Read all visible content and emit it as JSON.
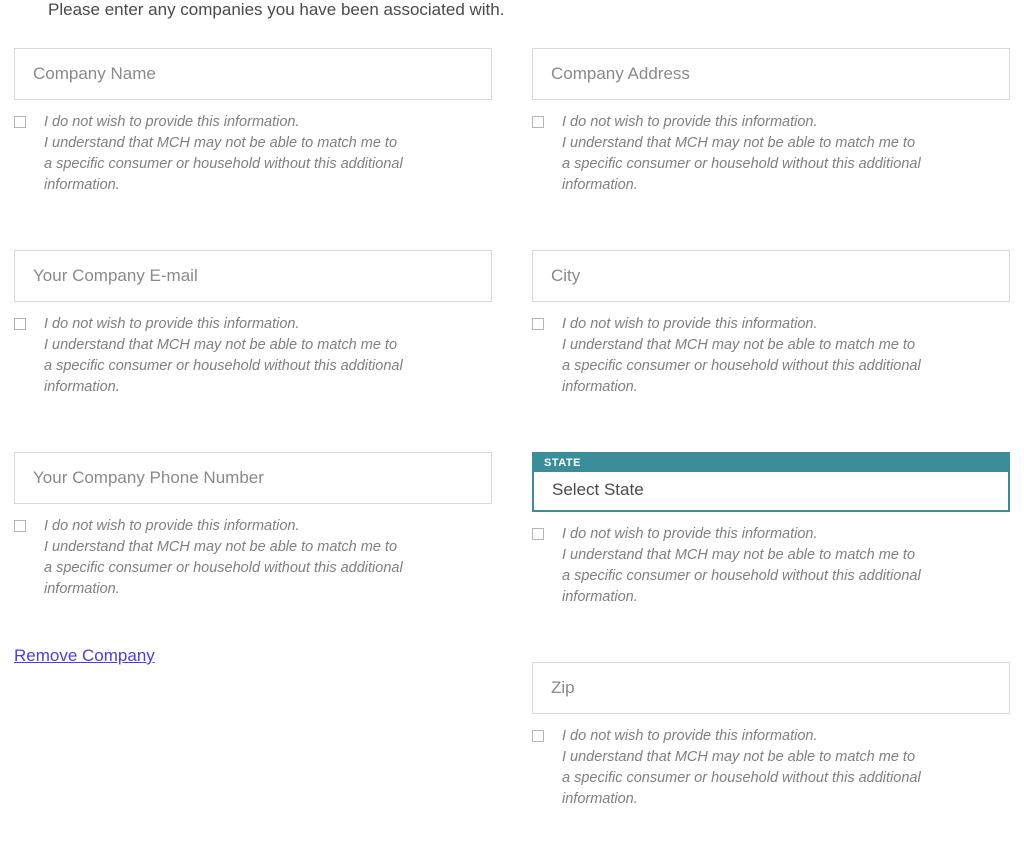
{
  "intro": "Please enter any companies you have been associated with.",
  "disclaimer": {
    "line1": "I do not wish to provide this information.",
    "line2": "I understand that MCH may not be able to match me to a specific consumer or household without this additional information."
  },
  "fields": {
    "company_name": {
      "placeholder": "Company Name"
    },
    "company_email": {
      "placeholder": "Your Company E-mail"
    },
    "company_phone": {
      "placeholder": "Your Company Phone Number"
    },
    "company_address": {
      "placeholder": "Company Address"
    },
    "city": {
      "placeholder": "City"
    },
    "state": {
      "label": "STATE",
      "value": "Select State"
    },
    "zip": {
      "placeholder": "Zip"
    }
  },
  "actions": {
    "remove_company": "Remove Company"
  }
}
